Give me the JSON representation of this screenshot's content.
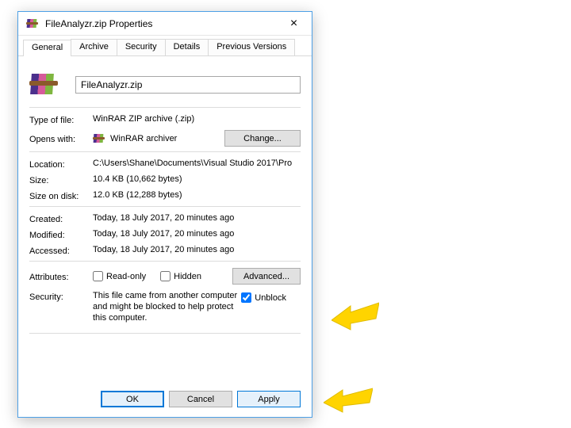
{
  "window": {
    "title": "FileAnalyzr.zip Properties",
    "close_glyph": "×"
  },
  "tabs": [
    "General",
    "Archive",
    "Security",
    "Details",
    "Previous Versions"
  ],
  "filename": "FileAnalyzr.zip",
  "labels": {
    "type_of_file": "Type of file:",
    "opens_with": "Opens with:",
    "location": "Location:",
    "size": "Size:",
    "size_on_disk": "Size on disk:",
    "created": "Created:",
    "modified": "Modified:",
    "accessed": "Accessed:",
    "attributes": "Attributes:",
    "security": "Security:"
  },
  "values": {
    "type_of_file": "WinRAR ZIP archive (.zip)",
    "opens_with": "WinRAR archiver",
    "location": "C:\\Users\\Shane\\Documents\\Visual Studio 2017\\Pro",
    "size": "10.4 KB (10,662 bytes)",
    "size_on_disk": "12.0 KB (12,288 bytes)",
    "created": "Today, 18 July 2017, 20 minutes ago",
    "modified": "Today, 18 July 2017, 20 minutes ago",
    "accessed": "Today, 18 July 2017, 20 minutes ago",
    "security_text": "This file came from another computer and might be blocked to help protect this computer."
  },
  "buttons": {
    "change": "Change...",
    "advanced": "Advanced...",
    "ok": "OK",
    "cancel": "Cancel",
    "apply": "Apply"
  },
  "checkboxes": {
    "read_only": "Read-only",
    "hidden": "Hidden",
    "unblock": "Unblock"
  },
  "icons": {
    "app": "winrar-icon"
  }
}
